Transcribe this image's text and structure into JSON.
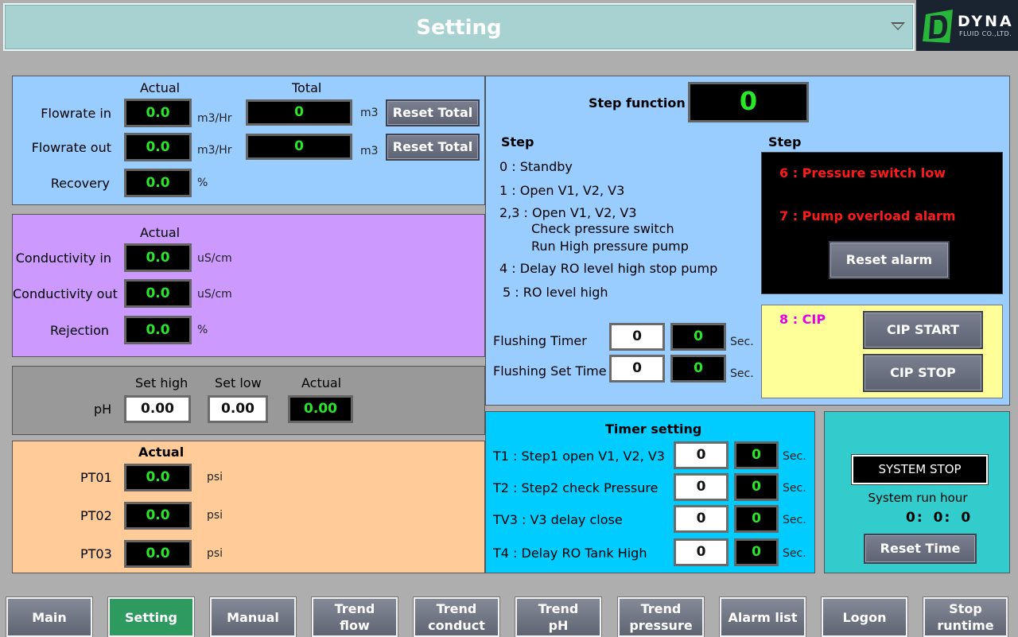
{
  "header": {
    "title": "Setting",
    "logo_text": "DYNA",
    "logo_sub": "FLUID CO.,LTD."
  },
  "flow": {
    "col_actual": "Actual",
    "col_total": "Total",
    "rows": [
      {
        "label": "Flowrate in",
        "actual": "0.0",
        "actual_unit": "m3/Hr",
        "total": "0",
        "total_unit": "m3",
        "button": "Reset Total"
      },
      {
        "label": "Flowrate out",
        "actual": "0.0",
        "actual_unit": "m3/Hr",
        "total": "0",
        "total_unit": "m3",
        "button": "Reset Total"
      },
      {
        "label": "Recovery",
        "actual": "0.0",
        "actual_unit": "%"
      }
    ]
  },
  "conductivity": {
    "col_actual": "Actual",
    "rows": [
      {
        "label": "Conductivity in",
        "value": "0.0",
        "unit": "uS/cm"
      },
      {
        "label": "Conductivity out",
        "value": "0.0",
        "unit": "uS/cm"
      },
      {
        "label": "Rejection",
        "value": "0.0",
        "unit": "%"
      }
    ]
  },
  "ph": {
    "label": "pH",
    "set_high_label": "Set high",
    "set_low_label": "Set low",
    "actual_label": "Actual",
    "set_high": "0.00",
    "set_low": "0.00",
    "actual": "0.00"
  },
  "pressure": {
    "col_actual": "Actual",
    "rows": [
      {
        "label": "PT01",
        "value": "0.0",
        "unit": "psi"
      },
      {
        "label": "PT02",
        "value": "0.0",
        "unit": "psi"
      },
      {
        "label": "PT03",
        "value": "0.0",
        "unit": "psi"
      }
    ]
  },
  "step": {
    "function_label": "Step function",
    "function_value": "0",
    "list_header": "Step",
    "items": [
      "0 : Standby",
      "1 : Open V1, V2, V3",
      "2,3 : Open V1, V2, V3",
      "Check pressure switch",
      "Run High pressure pump",
      "4 : Delay RO level high stop pump",
      "5 : RO level high"
    ],
    "alarm_header": "Step",
    "alarms": [
      "6 : Pressure switch low",
      "7 : Pump overload alarm"
    ],
    "reset_alarm": "Reset alarm",
    "cip_label": "8 : CIP",
    "cip_start": "CIP START",
    "cip_stop": "CIP STOP",
    "flushing": [
      {
        "label": "Flushing Timer",
        "set": "0",
        "actual": "0",
        "unit": "Sec."
      },
      {
        "label": "Flushing Set Time",
        "set": "0",
        "actual": "0",
        "unit": "Sec."
      }
    ]
  },
  "timer": {
    "title": "Timer setting",
    "rows": [
      {
        "label": "T1 : Step1 open V1, V2, V3",
        "set": "0",
        "actual": "0",
        "unit": "Sec."
      },
      {
        "label": "T2 : Step2 check Pressure",
        "set": "0",
        "actual": "0",
        "unit": "Sec."
      },
      {
        "label": "TV3 : V3 delay close",
        "set": "0",
        "actual": "0",
        "unit": "Sec."
      },
      {
        "label": "T4 : Delay RO Tank High",
        "set": "0",
        "actual": "0",
        "unit": "Sec."
      }
    ]
  },
  "system": {
    "status": "SYSTEM STOP",
    "run_hour_label": "System run hour",
    "h": "0",
    "m": "0",
    "s": "0",
    "sep": ":",
    "reset": "Reset Time"
  },
  "nav": [
    {
      "label": "Main"
    },
    {
      "label": "Setting"
    },
    {
      "label": "Manual"
    },
    {
      "label": "Trend flow"
    },
    {
      "label": "Trend conduct"
    },
    {
      "label": "Trend pH"
    },
    {
      "label": "Trend pressure"
    },
    {
      "label": "Alarm list"
    },
    {
      "label": "Logon"
    },
    {
      "label": "Stop runtime"
    }
  ],
  "colors": {
    "flow_bg": "#99ccff",
    "cond_bg": "#cc99ff",
    "ph_bg": "#999999",
    "pressure_bg": "#ffcc99",
    "step_bg": "#99ccff",
    "timer_bg": "#00ccff",
    "system_bg": "#33cccc",
    "cip_bg": "#ffff99",
    "alarm_text": "#ff1a1a",
    "cip_text": "#e600e6",
    "display_text": "#29e629"
  }
}
